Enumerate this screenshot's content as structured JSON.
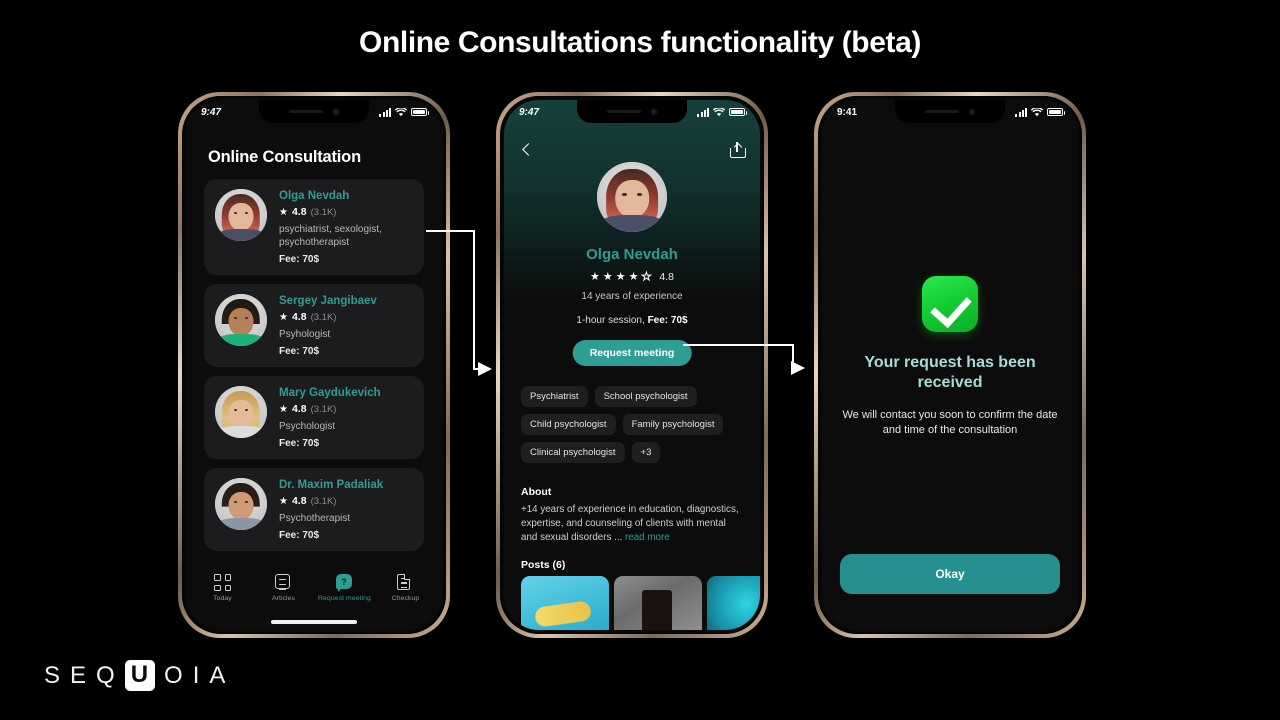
{
  "page": {
    "title": "Online Consultations functionality (beta)",
    "background_color": "#000000",
    "accent_color": "#2e9e93"
  },
  "logo": {
    "letters": [
      "S",
      "E",
      "Q",
      "U",
      "O",
      "I",
      "A"
    ],
    "highlight_letter": "U"
  },
  "phone1": {
    "status_bar": {
      "time": "9:47",
      "signal_icon": "cellular-bars-icon",
      "wifi_icon": "wifi-icon",
      "battery_icon": "battery-icon"
    },
    "screen_title": "Online Consultation",
    "doctors": [
      {
        "name": "Olga Nevdah",
        "star_icon": "star-icon",
        "rating": "4.8",
        "reviews": "(3.1K)",
        "specialty": "psychiatrist, sexologist, psychotherapist",
        "fee": "Fee: 70$"
      },
      {
        "name": "Sergey Jangibaev",
        "star_icon": "star-icon",
        "rating": "4.8",
        "reviews": "(3.1K)",
        "specialty": "Psyhologist",
        "fee": "Fee: 70$"
      },
      {
        "name": "Mary Gaydukevich",
        "star_icon": "star-icon",
        "rating": "4.8",
        "reviews": "(3.1K)",
        "specialty": "Psychologist",
        "fee": "Fee: 70$"
      },
      {
        "name": "Dr. Maxim Padaliak",
        "star_icon": "star-icon",
        "rating": "4.8",
        "reviews": "(3.1K)",
        "specialty": "Psychotherapist",
        "fee": "Fee: 70$"
      }
    ],
    "tabbar": [
      {
        "label": "Today",
        "icon": "grid-icon",
        "active": false
      },
      {
        "label": "Articles",
        "icon": "article-icon",
        "active": false
      },
      {
        "label": "Request meeting",
        "icon": "chat-question-icon",
        "active": true
      },
      {
        "label": "Checkup",
        "icon": "document-icon",
        "active": false
      }
    ]
  },
  "phone2": {
    "status_bar": {
      "time": "9:47",
      "signal_icon": "cellular-bars-icon",
      "wifi_icon": "wifi-icon",
      "battery_icon": "battery-icon"
    },
    "nav": {
      "back_icon": "chevron-left-icon",
      "share_icon": "share-icon"
    },
    "profile": {
      "name": "Olga Nevdah",
      "stars_filled": 4,
      "stars_total": 5,
      "rating": "4.8",
      "experience": "14 years of experience",
      "session_prefix": "1-hour session, ",
      "session_fee": "Fee: 70$"
    },
    "request_button": "Request meeting",
    "tags": [
      "Psychiatrist",
      "School psychologist",
      "Child psychologist",
      "Family psychologist",
      "Clinical psychologist",
      "+3"
    ],
    "about": {
      "heading": "About",
      "text": "+14 years of experience in education, diagnostics, expertise, and counseling of clients with mental and sexual disorders ... ",
      "read_more": "read more"
    },
    "posts": {
      "heading": "Posts (6)",
      "thumbnails": [
        "post-thumbnail-1",
        "post-thumbnail-2",
        "post-thumbnail-3"
      ]
    }
  },
  "phone3": {
    "status_bar": {
      "time": "9:41",
      "signal_icon": "cellular-bars-icon",
      "wifi_icon": "wifi-icon",
      "battery_icon": "battery-icon"
    },
    "success_icon": "green-checkmark-icon",
    "title": "Your request has been received",
    "subtitle": "We will contact you soon to confirm the date and time of the consultation",
    "button": "Okay"
  }
}
